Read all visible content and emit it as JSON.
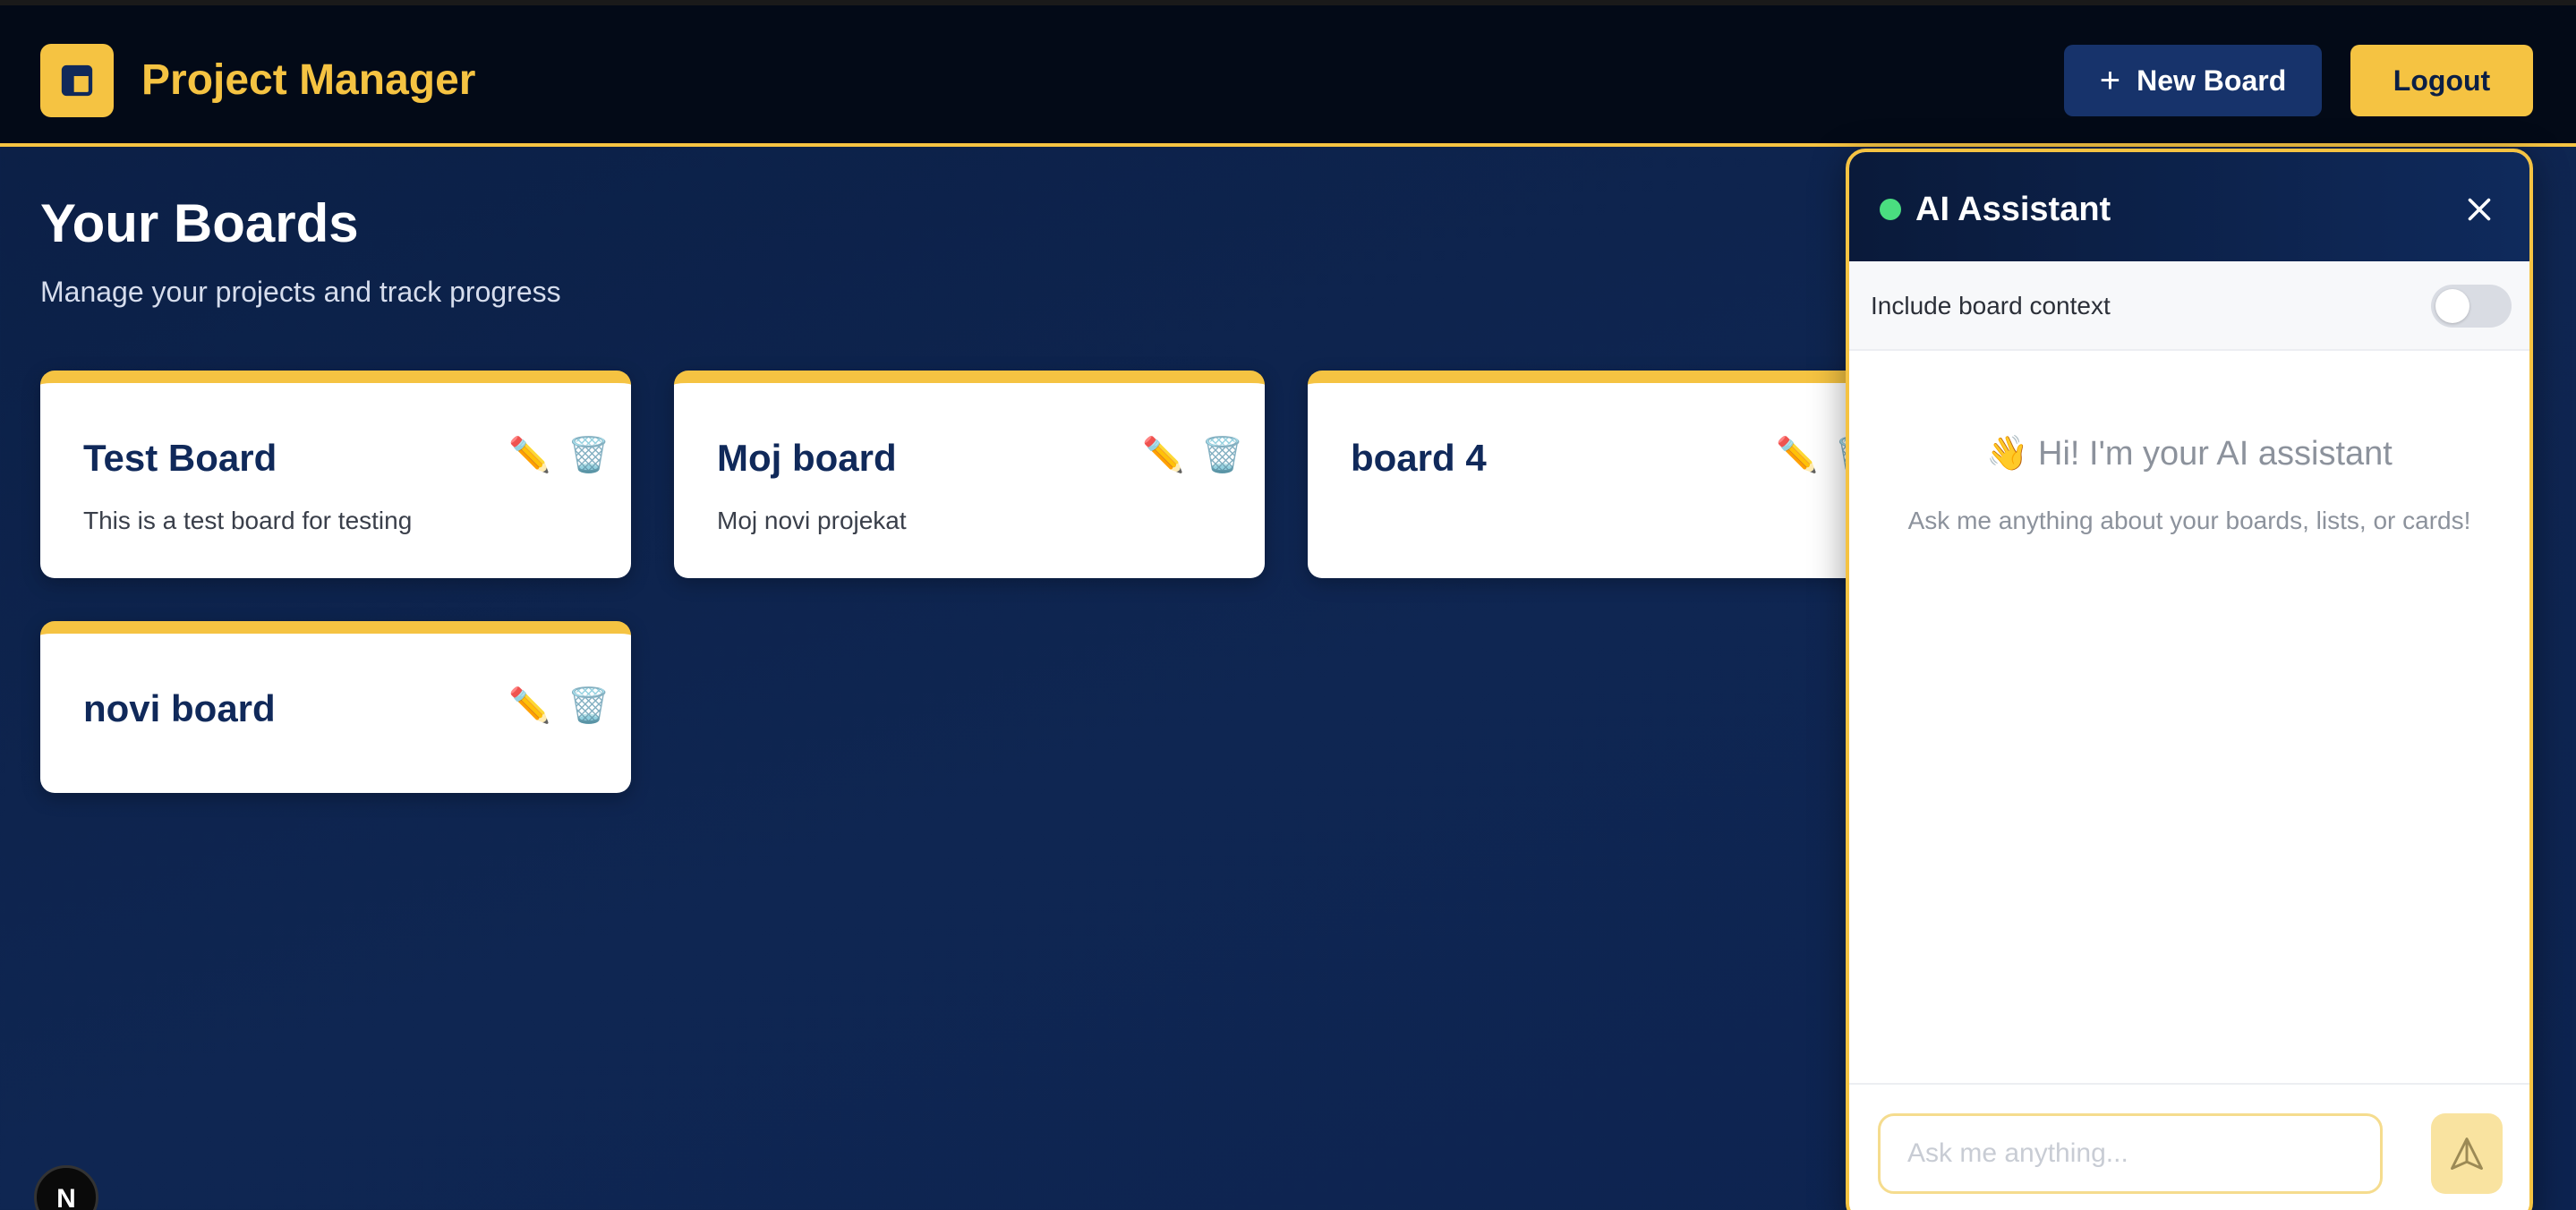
{
  "header": {
    "app_title": "Project Manager",
    "new_board_label": "New Board",
    "logout_label": "Logout",
    "logo_icon": "layout-icon"
  },
  "page": {
    "title": "Your Boards",
    "subtitle": "Manage your projects and track progress"
  },
  "boards": [
    {
      "name": "Test Board",
      "description": "This is a test board for testing"
    },
    {
      "name": "Moj board",
      "description": "Moj novi projekat"
    },
    {
      "name": "board 4",
      "description": ""
    },
    {
      "name": "novi board",
      "description": ""
    }
  ],
  "ai_panel": {
    "title": "AI Assistant",
    "status": "online",
    "context_label": "Include board context",
    "context_enabled": false,
    "welcome": "👋 Hi! I'm your AI assistant",
    "welcome_sub": "Ask me anything about your boards, lists, or cards!",
    "input_placeholder": "Ask me anything...",
    "send_icon": "send-icon"
  },
  "badge": {
    "label": "N"
  },
  "colors": {
    "accent": "#f5c342",
    "navy": "#0f2652",
    "header_bg": "#030a17",
    "status_online": "#4ade80"
  }
}
